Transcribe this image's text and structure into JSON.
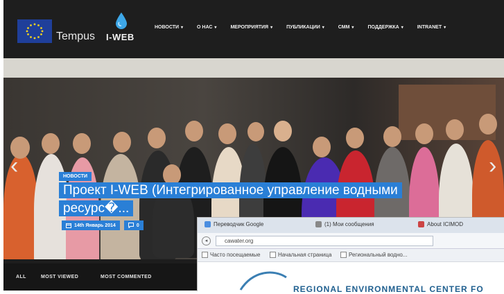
{
  "header": {
    "brand": "Tempus",
    "brand2": "I-WEB",
    "nav": [
      {
        "label": "НОВОСТИ"
      },
      {
        "label": "О НАС"
      },
      {
        "label": "МЕРОПРИЯТИЯ"
      },
      {
        "label": "ПУБЛИКАЦИИ"
      },
      {
        "label": "СММ"
      },
      {
        "label": "ПОДДЕРЖКА"
      },
      {
        "label": "INTRANET"
      }
    ],
    "caret": "▾"
  },
  "hero": {
    "category": "НОВОСТИ",
    "headline": "Проект I-WEB (Интегрированное управление водными ресурс�...",
    "date": "14th Январь 2014",
    "comments": "0",
    "arrow_left": "‹",
    "arrow_right": "›"
  },
  "tabs": {
    "all": "ALL",
    "most_viewed": "MOST VIEWED",
    "most_commented": "MOST COMMENTED"
  },
  "inset": {
    "tabs": [
      {
        "label": "Переводчик Google"
      },
      {
        "label": "(1) Мои сообщения"
      },
      {
        "label": "About ICIMOD"
      }
    ],
    "url": "cawater.org",
    "bookmarks": [
      {
        "label": "Часто посещаемые"
      },
      {
        "label": "Начальная страница"
      },
      {
        "label": "Региональный водно..."
      }
    ],
    "title_partial": "REGIONAL ENVIRONMENTAL CENTER FO"
  },
  "colors": {
    "accent": "#2a7fd6",
    "header_bg": "#1e1e1e",
    "eu_blue": "#1f3f9a"
  }
}
